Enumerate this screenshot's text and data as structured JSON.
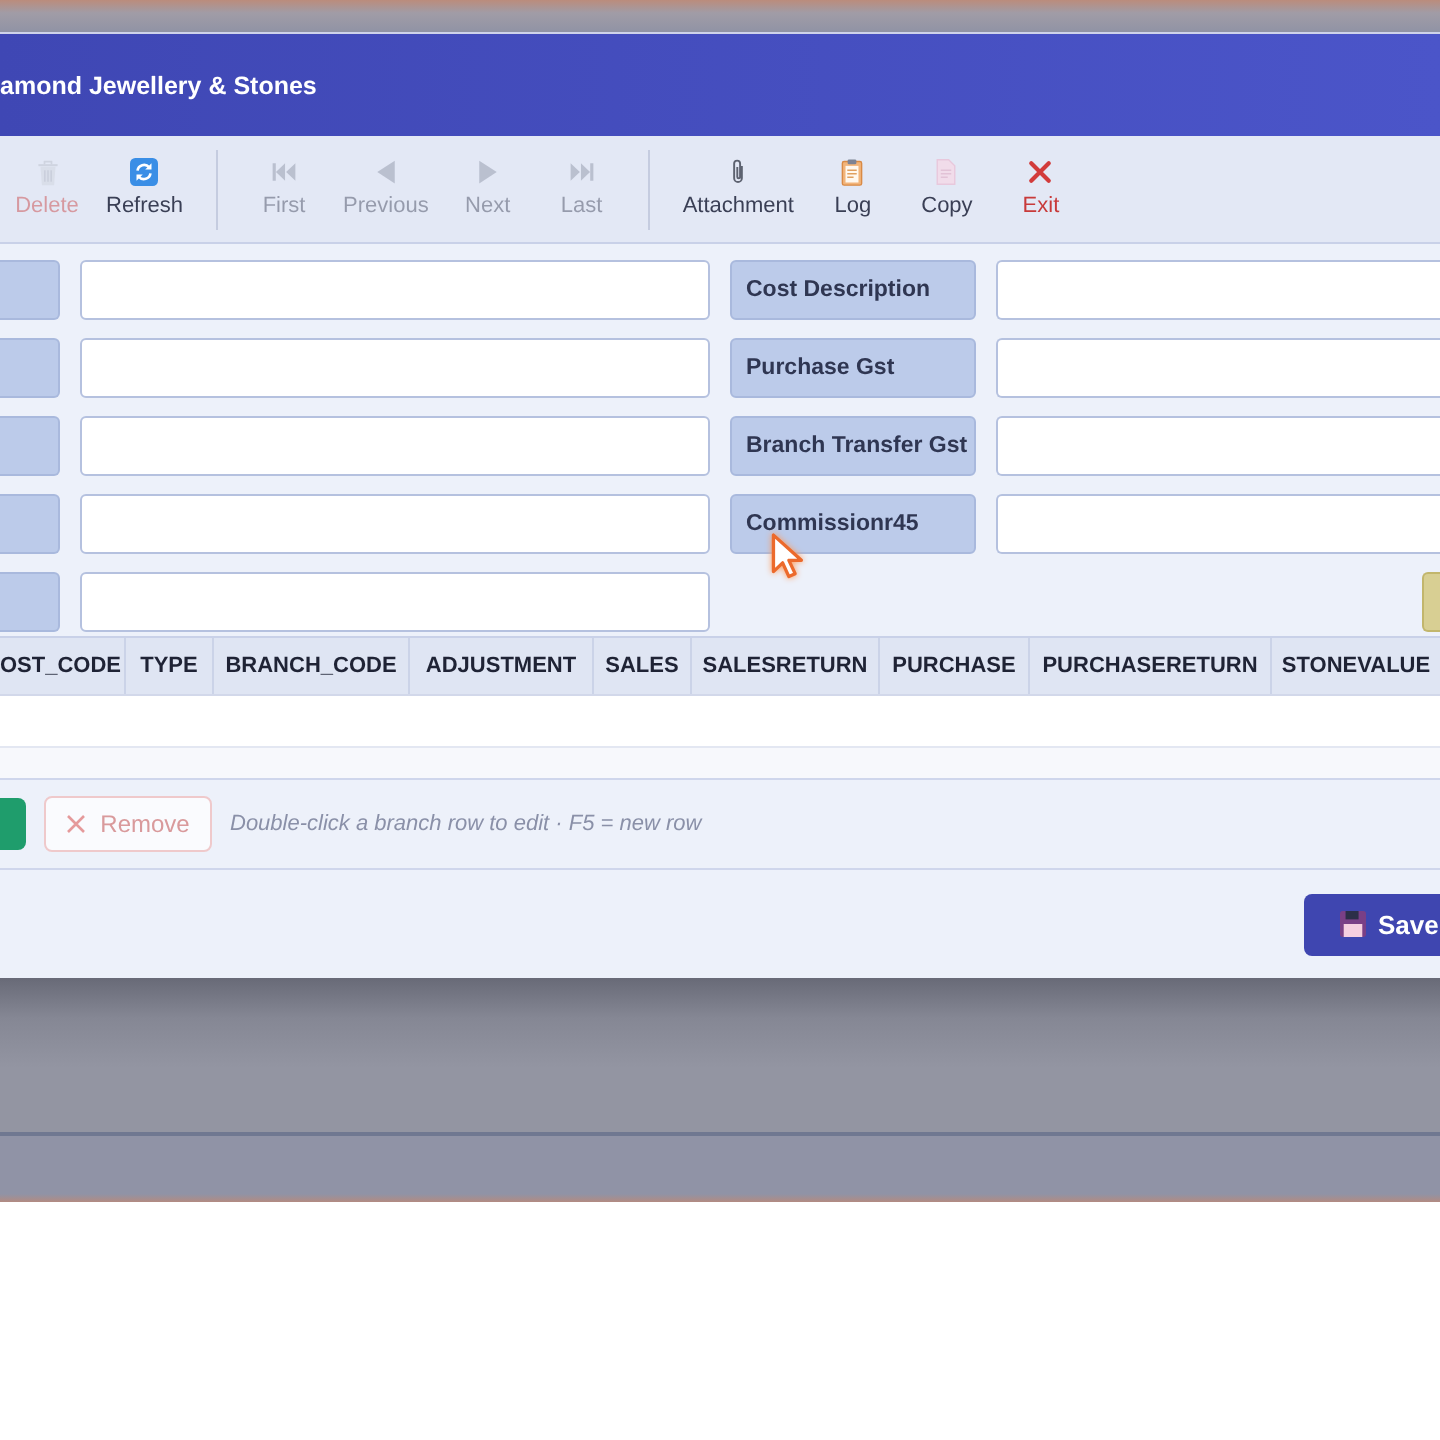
{
  "dialog": {
    "title": "amond Jewellery & Stones"
  },
  "toolbar": {
    "groups": [
      [
        {
          "label": "Delete",
          "kind": "delete",
          "disabled": true
        },
        {
          "label": "Refresh",
          "kind": "refresh",
          "disabled": false
        }
      ],
      [
        {
          "label": "First",
          "kind": "first",
          "disabled": true
        },
        {
          "label": "Previous",
          "kind": "previous",
          "disabled": true
        },
        {
          "label": "Next",
          "kind": "next",
          "disabled": true
        },
        {
          "label": "Last",
          "kind": "last",
          "disabled": true
        }
      ],
      [
        {
          "label": "Attachment",
          "kind": "attachment",
          "disabled": false
        },
        {
          "label": "Log",
          "kind": "log",
          "disabled": false
        },
        {
          "label": "Copy",
          "kind": "copy",
          "disabled": false
        },
        {
          "label": "Exit",
          "kind": "exit",
          "disabled": false
        }
      ]
    ]
  },
  "form": {
    "left_fields": [
      {
        "kind": "input"
      },
      {
        "kind": "input"
      },
      {
        "kind": "input"
      },
      {
        "kind": "input"
      },
      {
        "kind": "input"
      }
    ],
    "right_fields": [
      {
        "label": "Cost Description",
        "kind": "input"
      },
      {
        "label": "Purchase Gst",
        "kind": "input"
      },
      {
        "label": "Branch Transfer Gst",
        "kind": "input"
      },
      {
        "label": "Commissionr45",
        "kind": "input"
      }
    ],
    "side_button": {
      "kind": "accent"
    }
  },
  "table": {
    "columns": [
      "OST_CODE",
      "TYPE",
      "BRANCH_CODE",
      "ADJUSTMENT",
      "SALES",
      "SALESRETURN",
      "PURCHASE",
      "PURCHASERETURN",
      "STONEVALUE"
    ]
  },
  "row_actions": {
    "buttons": [
      {
        "kind": "primary"
      },
      {
        "kind": "remove",
        "label": "Remove",
        "disabled": true
      }
    ],
    "hint": "Double-click a branch row to edit · F5 = new row"
  },
  "footer": {
    "buttons": [
      {
        "kind": "save",
        "label": "Save"
      }
    ]
  }
}
